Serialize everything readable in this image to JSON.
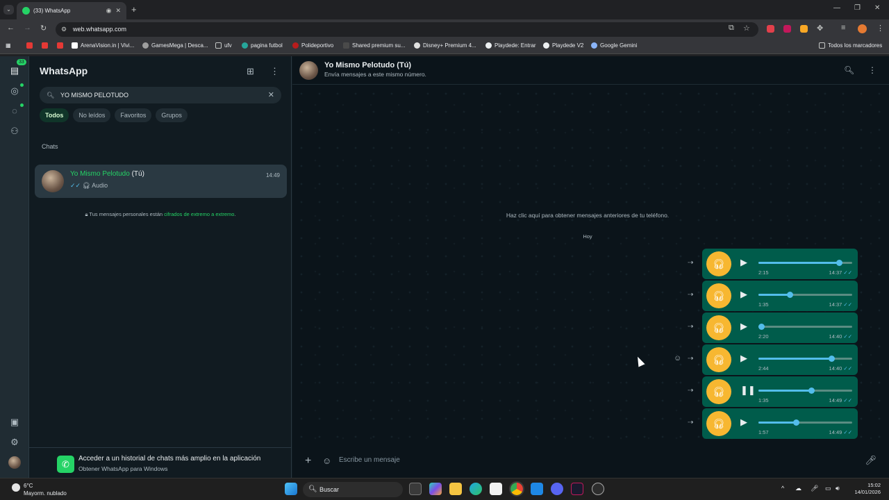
{
  "browser": {
    "tab_title": "(33) WhatsApp",
    "url": "web.whatsapp.com",
    "bookmarks": [
      "ArenaVision.in | Vivi...",
      "GamesMega | Desca...",
      "ufv",
      "pagina futbol",
      "Polideportivo",
      "Shared premium su...",
      "Disney+ Premium 4...",
      "Playdede: Entrar",
      "Playdede V2",
      "Google Gemini"
    ],
    "all_bookmarks": "Todos los marcadores"
  },
  "rail": {
    "badge": "33"
  },
  "sidebar": {
    "title": "WhatsApp",
    "search_value": "YO MISMO PELOTUDO",
    "filters": [
      "Todos",
      "No leídos",
      "Favoritos",
      "Grupos"
    ],
    "section_label": "Chats",
    "chat": {
      "name": "Yo Mismo Pelotudo",
      "suffix": " (Tú)",
      "time": "14:49",
      "preview": "Audio"
    },
    "encryption_text": "Tus mensajes personales están ",
    "encryption_link": "cifrados de extremo a extremo",
    "encryption_end": ".",
    "promo_title": "Acceder a un historial de chats más amplio en la aplicación",
    "promo_sub": "Obtener WhatsApp para Windows"
  },
  "chat": {
    "header_name": "Yo Mismo Pelotudo (Tú)",
    "header_sub": "Envía mensajes a este mismo número.",
    "load_more": "Haz clic aquí para obtener mensajes anteriores de tu teléfono.",
    "day": "Hoy",
    "compose_placeholder": "Escribe un mensaje",
    "messages": [
      {
        "duration": "2:15",
        "time": "14:37",
        "progress": 0.86,
        "playing": false
      },
      {
        "duration": "1:35",
        "time": "14:37",
        "progress": 0.33,
        "playing": false
      },
      {
        "duration": "2:20",
        "time": "14:40",
        "progress": 0.03,
        "playing": false
      },
      {
        "duration": "2:44",
        "time": "14:40",
        "progress": 0.78,
        "playing": false
      },
      {
        "duration": "1:35",
        "time": "14:49",
        "progress": 0.56,
        "playing": true
      },
      {
        "duration": "1:57",
        "time": "14:49",
        "progress": 0.4,
        "playing": false
      }
    ]
  },
  "taskbar": {
    "temp": "6°C",
    "weather": "Mayorm. nublado",
    "search_label": "Buscar",
    "time": "15:02",
    "date": "14/01/2026"
  },
  "colors": {
    "accent": "#25d366",
    "bubble": "#005c4b",
    "headphone": "#f7b731",
    "tick": "#53bdeb"
  }
}
